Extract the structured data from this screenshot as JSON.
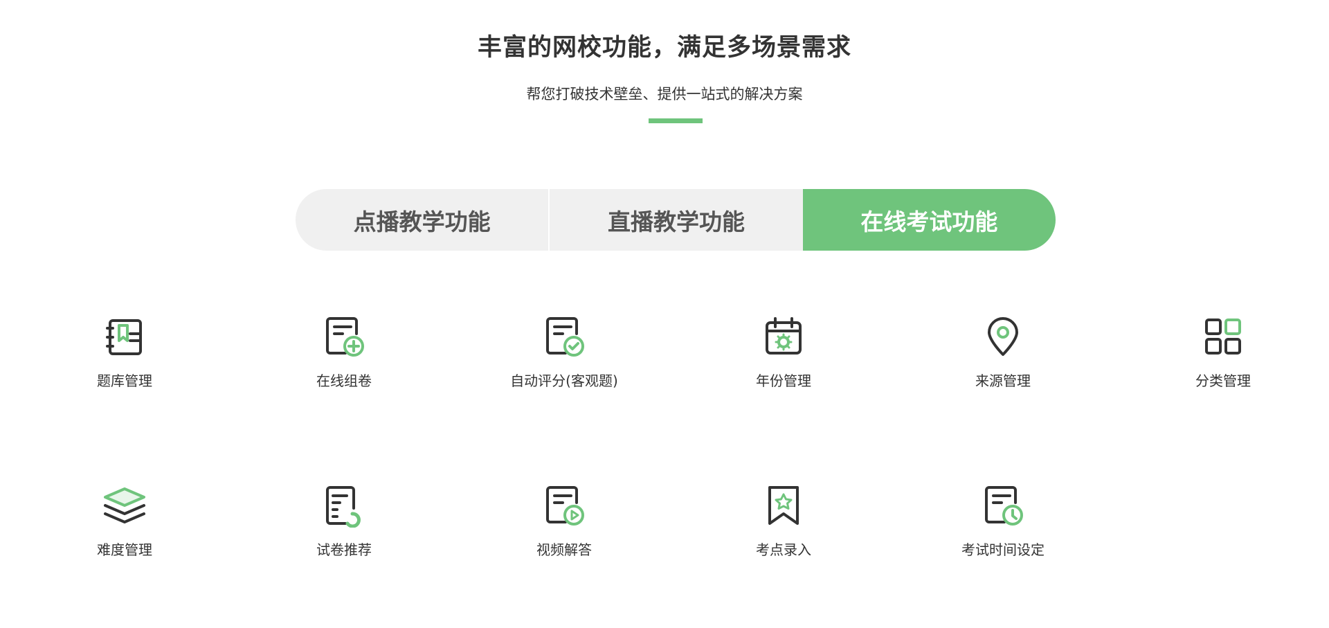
{
  "header": {
    "title": "丰富的网校功能，满足多场景需求",
    "subtitle": "帮您打破技术壁垒、提供一站式的解决方案",
    "accent_color": "#6fc47c"
  },
  "tabs": [
    {
      "label": "点播教学功能",
      "active": false
    },
    {
      "label": "直播教学功能",
      "active": false
    },
    {
      "label": "在线考试功能",
      "active": true
    }
  ],
  "features": [
    {
      "label": "题库管理",
      "icon": "question-bank-icon"
    },
    {
      "label": "在线组卷",
      "icon": "paper-add-icon"
    },
    {
      "label": "自动评分(客观题)",
      "icon": "auto-grade-icon"
    },
    {
      "label": "年份管理",
      "icon": "calendar-gear-icon"
    },
    {
      "label": "来源管理",
      "icon": "location-pin-icon"
    },
    {
      "label": "分类管理",
      "icon": "category-grid-icon"
    },
    {
      "label": "难度管理",
      "icon": "layers-icon"
    },
    {
      "label": "试卷推荐",
      "icon": "paper-recommend-icon"
    },
    {
      "label": "视频解答",
      "icon": "video-answer-icon"
    },
    {
      "label": "考点录入",
      "icon": "bookmark-star-icon"
    },
    {
      "label": "考试时间设定",
      "icon": "exam-clock-icon"
    }
  ]
}
